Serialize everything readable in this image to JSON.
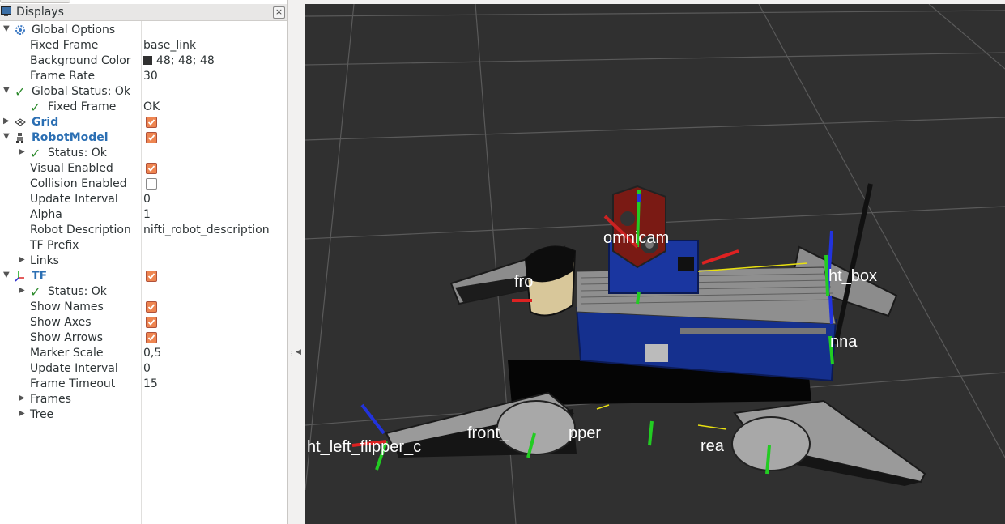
{
  "panel": {
    "title": "Displays",
    "close_label": "×"
  },
  "tree": {
    "global_options": {
      "label": "Global Options"
    },
    "fixed_frame": {
      "label": "Fixed Frame",
      "value": "base_link"
    },
    "background_color": {
      "label": "Background Color",
      "value": "48; 48; 48",
      "swatch_color": "#303030"
    },
    "frame_rate": {
      "label": "Frame Rate",
      "value": "30"
    },
    "global_status": {
      "label": "Global Status: Ok"
    },
    "gs_fixed_frame": {
      "label": "Fixed Frame",
      "value": "OK"
    },
    "grid": {
      "label": "Grid",
      "checked": true
    },
    "robot_model": {
      "label": "RobotModel",
      "checked": true
    },
    "rm_status": {
      "label": "Status: Ok"
    },
    "visual_enabled": {
      "label": "Visual Enabled",
      "checked": true
    },
    "collision_enabled": {
      "label": "Collision Enabled",
      "checked": false
    },
    "rm_update_interval": {
      "label": "Update Interval",
      "value": "0"
    },
    "alpha": {
      "label": "Alpha",
      "value": "1"
    },
    "robot_description": {
      "label": "Robot Description",
      "value": "nifti_robot_description"
    },
    "tf_prefix": {
      "label": "TF Prefix",
      "value": ""
    },
    "links": {
      "label": "Links"
    },
    "tf": {
      "label": "TF",
      "checked": true
    },
    "tf_status": {
      "label": "Status: Ok"
    },
    "show_names": {
      "label": "Show Names",
      "checked": true
    },
    "show_axes": {
      "label": "Show Axes",
      "checked": true
    },
    "show_arrows": {
      "label": "Show Arrows",
      "checked": true
    },
    "marker_scale": {
      "label": "Marker Scale",
      "value": "0,5"
    },
    "tf_update_interval": {
      "label": "Update Interval",
      "value": "0"
    },
    "frame_timeout": {
      "label": "Frame Timeout",
      "value": "15"
    },
    "frames": {
      "label": "Frames"
    },
    "tree_node": {
      "label": "Tree"
    }
  },
  "viewport": {
    "background": "#303030",
    "frame_labels": [
      "omnicam",
      "ht_box",
      "nna",
      "ht_left_flipper_c",
      "front_",
      "pper",
      "rea",
      "fro"
    ]
  },
  "colors": {
    "accent_checkbox": "#ee8550",
    "link_blue": "#2b6fb3",
    "status_green": "#2e8b2e"
  }
}
